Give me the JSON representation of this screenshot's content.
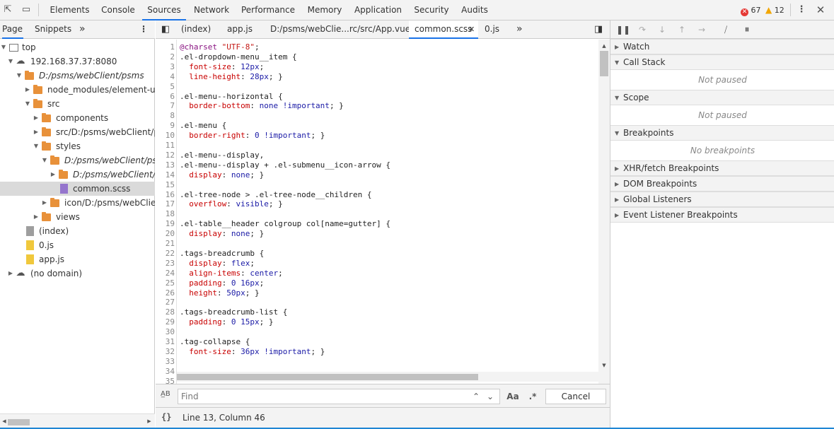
{
  "toolbar": {
    "tabs": [
      "Elements",
      "Console",
      "Sources",
      "Network",
      "Performance",
      "Memory",
      "Application",
      "Security",
      "Audits"
    ],
    "active_tab": "Sources",
    "error_count": "67",
    "warning_count": "12"
  },
  "navigator": {
    "tabs": [
      "Page",
      "Snippets"
    ],
    "more": "»",
    "tree": [
      {
        "label": "top"
      },
      {
        "label": "192.168.37.37:8080"
      },
      {
        "label": "D:/psms/webClient/psms"
      },
      {
        "label": "node_modules/element-ui/lib"
      },
      {
        "label": "src"
      },
      {
        "label": "components"
      },
      {
        "label": "src/D:/psms/webClient/psms"
      },
      {
        "label": "styles"
      },
      {
        "label": "D:/psms/webClient/psms"
      },
      {
        "label": "D:/psms/webClient/psms"
      },
      {
        "label": "common.scss"
      },
      {
        "label": "icon/D:/psms/webClient/psms"
      },
      {
        "label": "views"
      },
      {
        "label": "(index)"
      },
      {
        "label": "0.js"
      },
      {
        "label": "app.js"
      },
      {
        "label": "(no domain)"
      }
    ]
  },
  "editor": {
    "tabs": [
      "(index)",
      "app.js",
      "D:/psms/webClie...rc/src/App.vue",
      "common.scss",
      "0.js"
    ],
    "active_tab": "common.scss",
    "more": "»",
    "lines": [
      {
        "n": "1",
        "text": "@charset \"UTF-8\";"
      },
      {
        "n": "2",
        "text": ".el-dropdown-menu__item {"
      },
      {
        "n": "3",
        "text": "  font-size: 12px;"
      },
      {
        "n": "4",
        "text": "  line-height: 28px; }"
      },
      {
        "n": "5",
        "text": ""
      },
      {
        "n": "6",
        "text": ".el-menu--horizontal {"
      },
      {
        "n": "7",
        "text": "  border-bottom: none !important; }"
      },
      {
        "n": "8",
        "text": ""
      },
      {
        "n": "9",
        "text": ".el-menu {"
      },
      {
        "n": "10",
        "text": "  border-right: 0 !important; }"
      },
      {
        "n": "11",
        "text": ""
      },
      {
        "n": "12",
        "text": ".el-menu--display,"
      },
      {
        "n": "13",
        "text": ".el-menu--display + .el-submenu__icon-arrow {"
      },
      {
        "n": "14",
        "text": "  display: none; }"
      },
      {
        "n": "15",
        "text": ""
      },
      {
        "n": "16",
        "text": ".el-tree-node > .el-tree-node__children {"
      },
      {
        "n": "17",
        "text": "  overflow: visible; }"
      },
      {
        "n": "18",
        "text": ""
      },
      {
        "n": "19",
        "text": ".el-table__header colgroup col[name=gutter] {"
      },
      {
        "n": "20",
        "text": "  display: none; }"
      },
      {
        "n": "21",
        "text": ""
      },
      {
        "n": "22",
        "text": ".tags-breadcrumb {"
      },
      {
        "n": "23",
        "text": "  display: flex;"
      },
      {
        "n": "24",
        "text": "  align-items: center;"
      },
      {
        "n": "25",
        "text": "  padding: 0 16px;"
      },
      {
        "n": "26",
        "text": "  height: 50px; }"
      },
      {
        "n": "27",
        "text": ""
      },
      {
        "n": "28",
        "text": ".tags-breadcrumb-list {"
      },
      {
        "n": "29",
        "text": "  padding: 0 15px; }"
      },
      {
        "n": "30",
        "text": ""
      },
      {
        "n": "31",
        "text": ".tag-collapse {"
      },
      {
        "n": "32",
        "text": "  font-size: 36px !important; }"
      },
      {
        "n": "33",
        "text": ""
      },
      {
        "n": "34",
        "text": ""
      },
      {
        "n": "35",
        "text": ""
      }
    ],
    "find_placeholder": "Find",
    "match_case_label": "Aa",
    "regex_label": ".*",
    "cancel_label": "Cancel",
    "status": "Line 13, Column 46",
    "status_icon": "{}"
  },
  "debugger": {
    "sections": [
      {
        "title": "Watch",
        "body": ""
      },
      {
        "title": "Call Stack",
        "body": "Not paused"
      },
      {
        "title": "Scope",
        "body": "Not paused"
      },
      {
        "title": "Breakpoints",
        "body": "No breakpoints"
      },
      {
        "title": "XHR/fetch Breakpoints",
        "body": ""
      },
      {
        "title": "DOM Breakpoints",
        "body": ""
      },
      {
        "title": "Global Listeners",
        "body": ""
      },
      {
        "title": "Event Listener Breakpoints",
        "body": ""
      }
    ]
  },
  "colors": {
    "accent": "#1a73e8",
    "folder": "#e8913a",
    "error": "#e53935",
    "warning": "#f2a600"
  }
}
